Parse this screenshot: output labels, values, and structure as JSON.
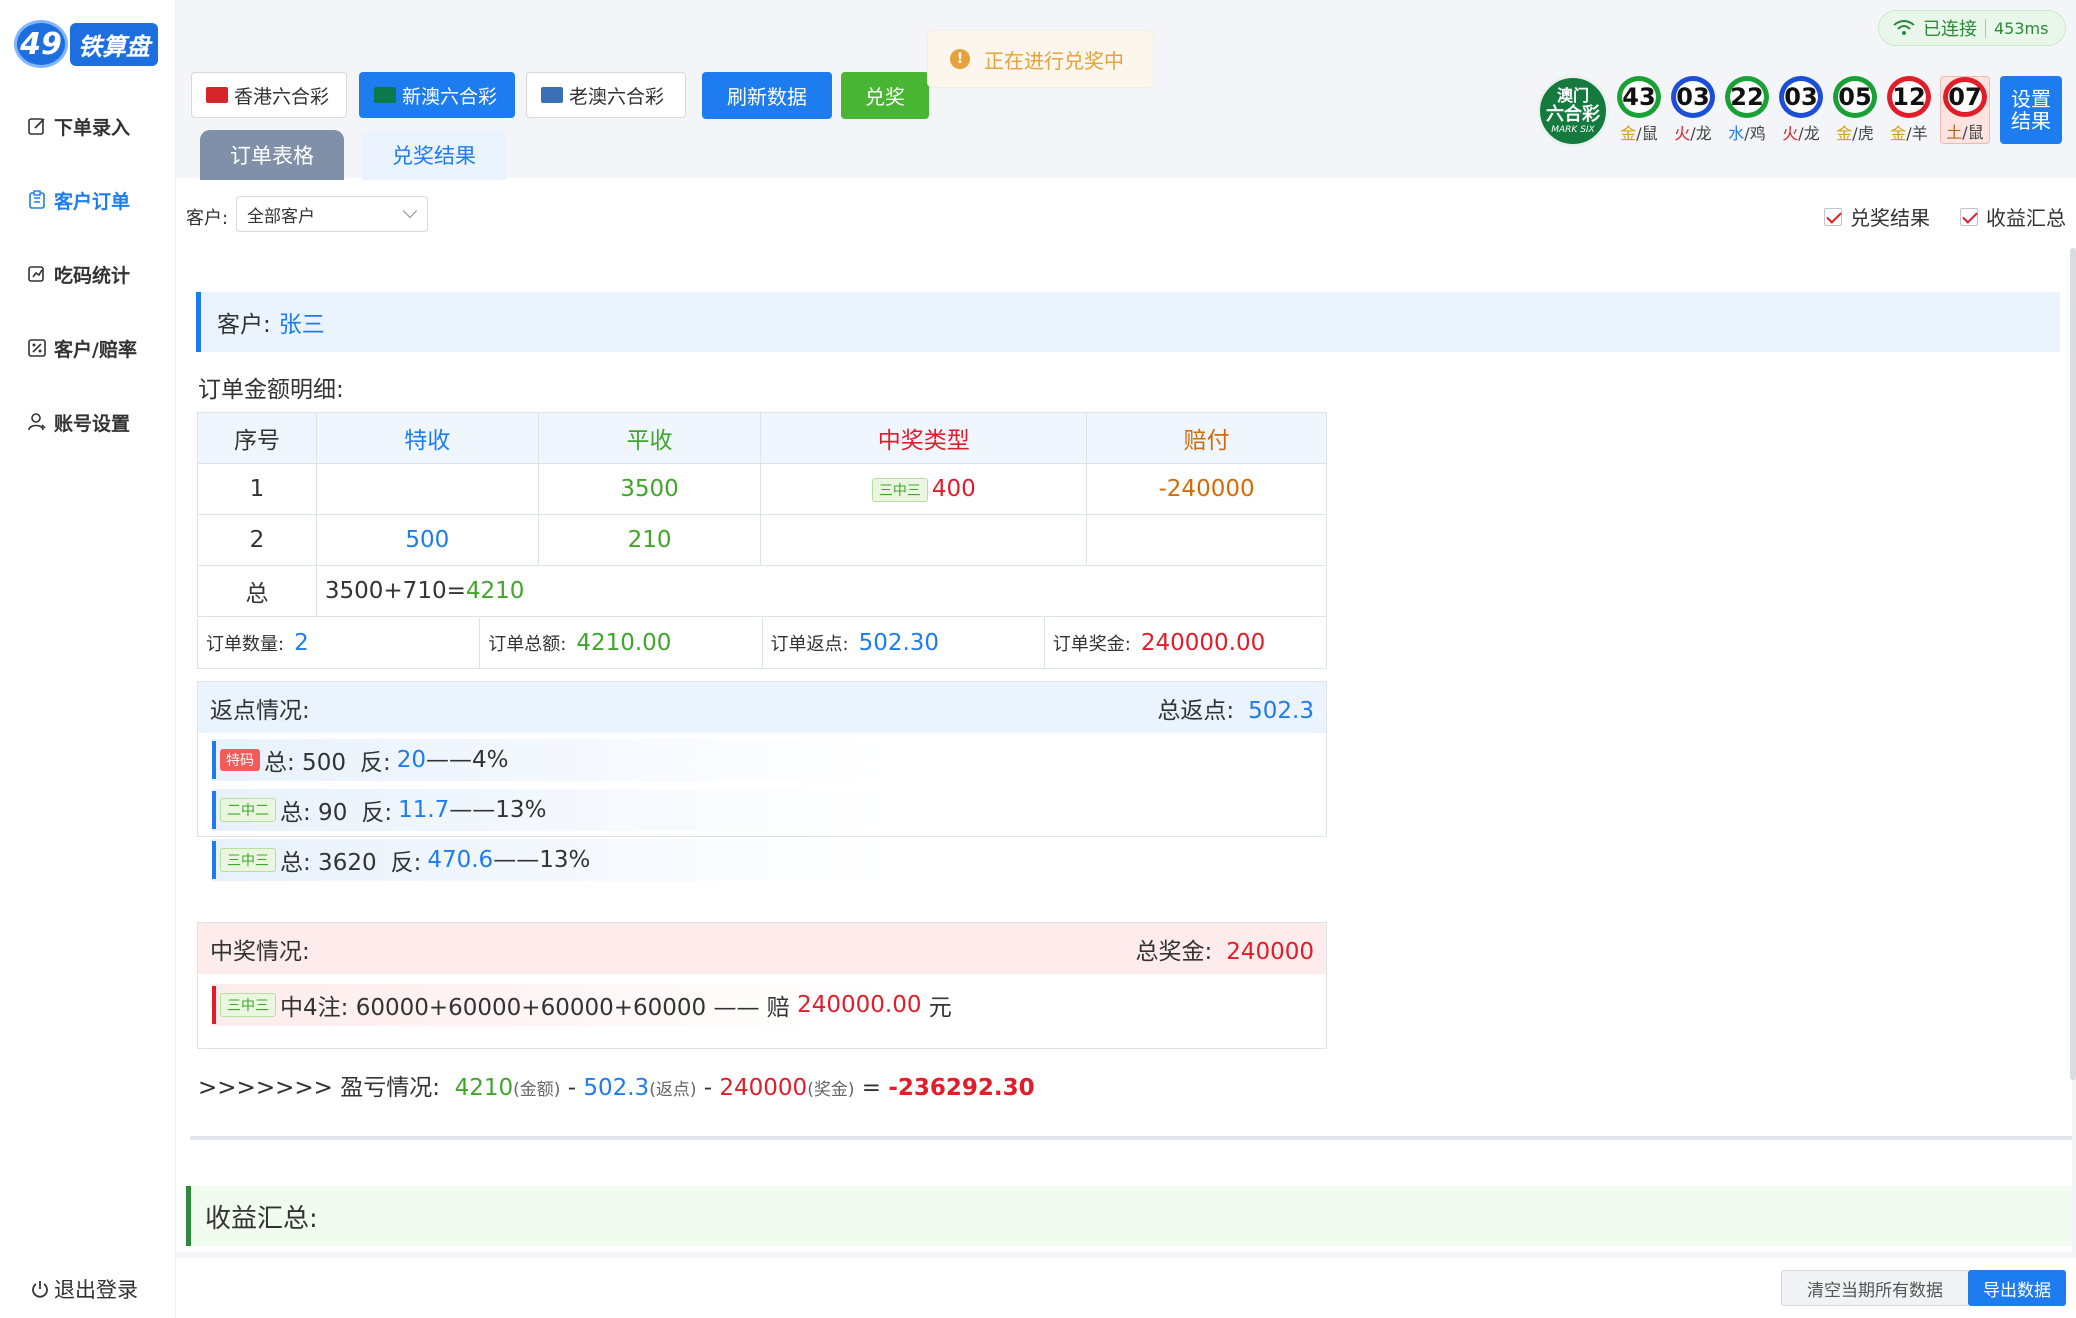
{
  "app": {
    "logo_num": "49",
    "logo_text": "铁算盘"
  },
  "sidebar": {
    "items": [
      {
        "label": "下单录入"
      },
      {
        "label": "客户订单"
      },
      {
        "label": "吃码统计"
      },
      {
        "label": "客户/赔率"
      },
      {
        "label": "账号设置"
      }
    ],
    "logout": "退出登录"
  },
  "toolbar": {
    "lotteries": [
      "香港六合彩",
      "新澳六合彩",
      "老澳六合彩"
    ],
    "refresh_label": "刷新数据",
    "redeem_label": "兑奖"
  },
  "toast": {
    "icon": "!",
    "text": "正在进行兑奖中"
  },
  "connection": {
    "status": "已连接",
    "latency": "453ms"
  },
  "tabs": [
    "订单表格",
    "兑奖结果"
  ],
  "results": {
    "seal": {
      "l1": "澳门",
      "l2": "六合彩",
      "l3": "MARK SIX"
    },
    "balls": [
      {
        "num": "43",
        "el": "金",
        "zodiac": "/鼠",
        "color": "green",
        "el_color": "#d4a017"
      },
      {
        "num": "03",
        "el": "火",
        "zodiac": "/龙",
        "color": "blue",
        "el_color": "#e11d2a"
      },
      {
        "num": "22",
        "el": "水",
        "zodiac": "/鸡",
        "color": "green",
        "el_color": "#1d7cf0"
      },
      {
        "num": "03",
        "el": "火",
        "zodiac": "/龙",
        "color": "blue",
        "el_color": "#e11d2a"
      },
      {
        "num": "05",
        "el": "金",
        "zodiac": "/虎",
        "color": "green",
        "el_color": "#d4a017"
      },
      {
        "num": "12",
        "el": "金",
        "zodiac": "/羊",
        "color": "red",
        "el_color": "#d4a017"
      },
      {
        "num": "07",
        "el": "土",
        "zodiac": "/鼠",
        "color": "red",
        "el_color": "#b5651d"
      }
    ],
    "set_label_1": "设置",
    "set_label_2": "结果"
  },
  "filter": {
    "customer_label": "客户:",
    "customer_value": "全部客户",
    "check_redeem": "兑奖结果",
    "check_income": "收益汇总"
  },
  "customer": {
    "label": "客户:",
    "name": "张三"
  },
  "order_detail": {
    "title": "订单金额明细:",
    "headers": [
      "序号",
      "特收",
      "平收",
      "中奖类型",
      "赔付"
    ],
    "rows": [
      {
        "no": "1",
        "te": "",
        "ping": "3500",
        "win_tag": "三中三",
        "win_val": "400",
        "pay": "-240000"
      },
      {
        "no": "2",
        "te": "500",
        "ping": "210",
        "win_tag": "",
        "win_val": "",
        "pay": ""
      }
    ],
    "total_label": "总",
    "total_expr": "3500+710=",
    "total_val": "4210",
    "summary": [
      {
        "label": "订单数量:",
        "value": "2",
        "color": "#1d7cf0"
      },
      {
        "label": "订单总额:",
        "value": "4210.00",
        "color": "#3fa62a"
      },
      {
        "label": "订单返点:",
        "value": "502.30",
        "color": "#1d7cf0"
      },
      {
        "label": "订单奖金:",
        "value": "240000.00",
        "color": "#e11d2a"
      }
    ]
  },
  "rebate": {
    "title": "返点情况:",
    "total_label": "总返点:",
    "total_value": "502.3",
    "lines": [
      {
        "tag": "特码",
        "tag_type": "r",
        "total": "总: 500",
        "rev_label": "反:",
        "rev": "20",
        "pct": "——4%"
      },
      {
        "tag": "二中二",
        "tag_type": "g",
        "total": "总: 90",
        "rev_label": "反:",
        "rev": "11.7",
        "pct": "——13%"
      },
      {
        "tag": "三中三",
        "tag_type": "g",
        "total": "总: 3620",
        "rev_label": "反:",
        "rev": "470.6",
        "pct": "——13%"
      }
    ]
  },
  "winning": {
    "title": "中奖情况:",
    "total_label": "总奖金:",
    "total_value": "240000",
    "line": {
      "tag": "三中三",
      "text": "中4注: 60000+60000+60000+60000 —— 赔 ",
      "amount": "240000.00",
      "unit": " 元"
    }
  },
  "profit": {
    "prefix": ">>>>>>> 盈亏情况:",
    "amount": "4210",
    "amount_note": "(金额)",
    "minus1": " - ",
    "rebate": "502.3",
    "rebate_note": "(返点)",
    "minus2": " - ",
    "bonus": "240000",
    "bonus_note": "(奖金)",
    "eq": " = ",
    "result": "-236292.30"
  },
  "income": {
    "title": "收益汇总:"
  },
  "footer": {
    "clear_label": "清空当期所有数据",
    "export_label": "导出数据"
  }
}
